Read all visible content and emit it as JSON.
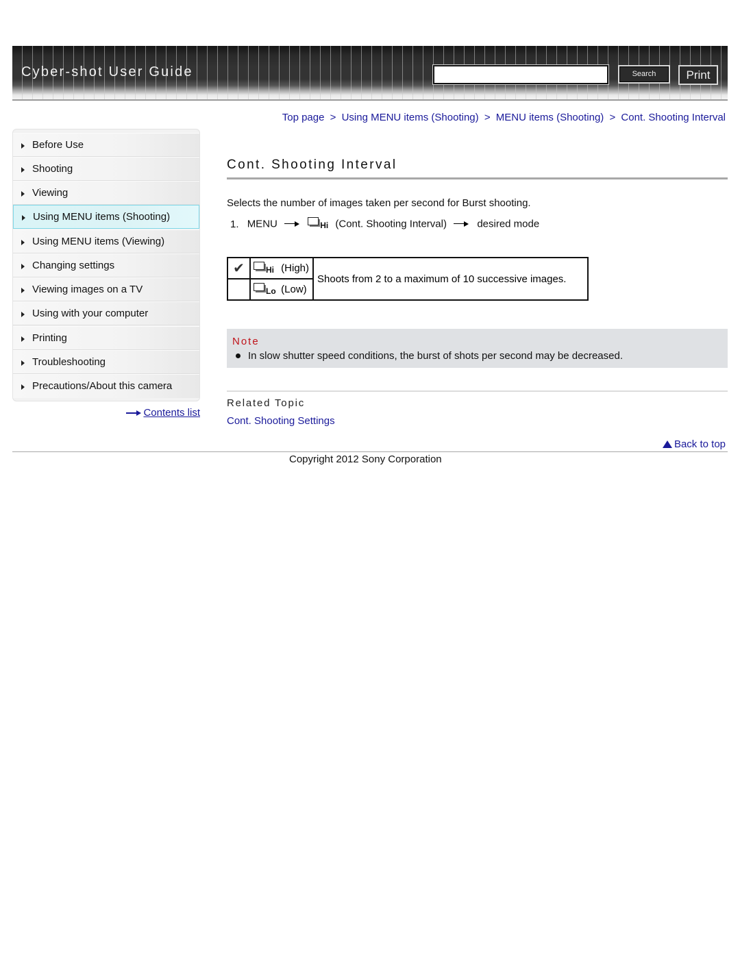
{
  "header": {
    "title": "Cyber-shot User Guide",
    "search": {
      "value": "",
      "placeholder": ""
    },
    "search_button": "Search",
    "print_button": "Print"
  },
  "breadcrumb": [
    {
      "label": "Top page"
    },
    {
      "label": "Using MENU items (Shooting)"
    },
    {
      "label": "MENU items (Shooting)"
    },
    {
      "label": "Cont. Shooting Interval"
    }
  ],
  "breadcrumb_separator": ">",
  "sidebar": {
    "items": [
      {
        "label": "Before Use",
        "active": false
      },
      {
        "label": "Shooting",
        "active": false
      },
      {
        "label": "Viewing",
        "active": false
      },
      {
        "label": "Using MENU items (Shooting)",
        "active": true
      },
      {
        "label": "Using MENU items (Viewing)",
        "active": false
      },
      {
        "label": "Changing settings",
        "active": false
      },
      {
        "label": "Viewing images on a TV",
        "active": false
      },
      {
        "label": "Using with your computer",
        "active": false
      },
      {
        "label": "Printing",
        "active": false
      },
      {
        "label": "Troubleshooting",
        "active": false
      },
      {
        "label": "Precautions/About this camera",
        "active": false
      }
    ],
    "contents_link": "Contents list"
  },
  "main": {
    "title": "Cont. Shooting Interval",
    "intro": "Selects the number of images taken per second for Burst shooting.",
    "step": {
      "number": "1.",
      "menu": "MENU",
      "icon_text": "Hi",
      "item": "(Cont. Shooting Interval)",
      "target": "desired mode"
    },
    "modes": [
      {
        "icon_text": "Hi",
        "label": "(High)",
        "default": true
      },
      {
        "icon_text": "Lo",
        "label": "(Low)",
        "default": false
      }
    ],
    "modes_description": "Shoots from 2 to a maximum of 10 successive images.",
    "note": {
      "title": "Note",
      "items": [
        "In slow shutter speed conditions, the burst of shots per second may be decreased."
      ]
    },
    "related": {
      "title": "Related Topic",
      "links": [
        "Cont. Shooting Settings"
      ]
    },
    "back_to_top": "Back to top"
  },
  "footer": {
    "copyright": "Copyright 2012 Sony Corporation"
  },
  "colors": {
    "link": "#1a1a9a",
    "note_title": "#c0141b",
    "note_bg": "#dfe1e4",
    "active_nav_bg": "#dcf3f5",
    "active_nav_border": "#7fd8e8"
  }
}
